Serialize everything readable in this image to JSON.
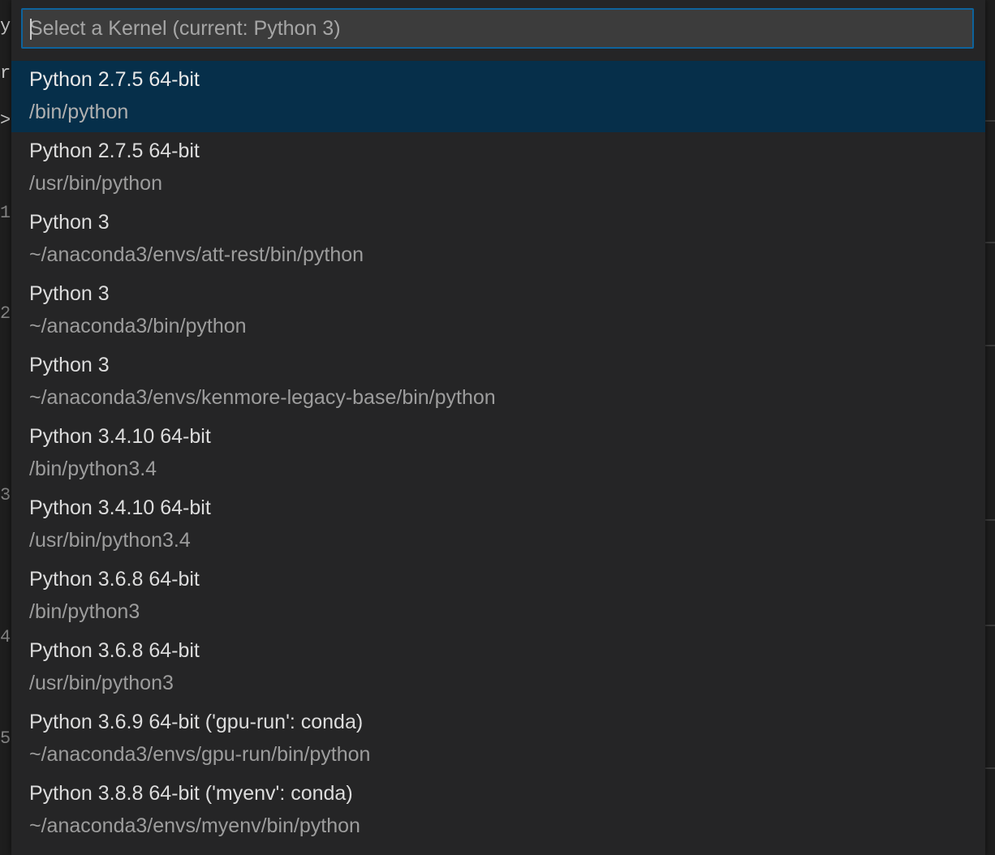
{
  "quick_pick": {
    "placeholder": "Select a Kernel (current: Python 3)",
    "value": "",
    "selected_index": 0,
    "items": [
      {
        "label": "Python 2.7.5 64-bit",
        "detail": "/bin/python"
      },
      {
        "label": "Python 2.7.5 64-bit",
        "detail": "/usr/bin/python"
      },
      {
        "label": "Python 3",
        "detail": "~/anaconda3/envs/att-rest/bin/python"
      },
      {
        "label": "Python 3",
        "detail": "~/anaconda3/bin/python"
      },
      {
        "label": "Python 3",
        "detail": "~/anaconda3/envs/kenmore-legacy-base/bin/python"
      },
      {
        "label": "Python 3.4.10 64-bit",
        "detail": "/bin/python3.4"
      },
      {
        "label": "Python 3.4.10 64-bit",
        "detail": "/usr/bin/python3.4"
      },
      {
        "label": "Python 3.6.8 64-bit",
        "detail": "/bin/python3"
      },
      {
        "label": "Python 3.6.8 64-bit",
        "detail": "/usr/bin/python3"
      },
      {
        "label": "Python 3.6.9 64-bit ('gpu-run': conda)",
        "detail": "~/anaconda3/envs/gpu-run/bin/python"
      },
      {
        "label": "Python 3.8.8 64-bit ('myenv': conda)",
        "detail": "~/anaconda3/envs/myenv/bin/python"
      }
    ]
  },
  "background_fragments": [
    "y",
    "ri",
    ">",
    "1",
    "2",
    "3",
    "4",
    "5"
  ],
  "colors": {
    "selection": "#062f4a",
    "focus_border": "#0e639c",
    "panel": "#252526",
    "input_background": "#3c3c3c"
  }
}
